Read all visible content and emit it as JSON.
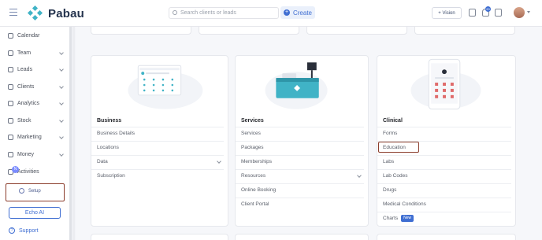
{
  "app": {
    "name": "Pabau",
    "brand_color": "#40b3c6",
    "accent_color": "#3f6ed2"
  },
  "header": {
    "search_placeholder": "Search clients or leads",
    "create_label": "Create",
    "vision_label": "+ Vision",
    "notification_count": "20"
  },
  "sidebar": {
    "items": [
      {
        "label": "Calendar",
        "icon": "calendar-icon",
        "has_caret": false
      },
      {
        "label": "Team",
        "icon": "team-icon",
        "has_caret": true
      },
      {
        "label": "Leads",
        "icon": "leads-icon",
        "has_caret": true
      },
      {
        "label": "Clients",
        "icon": "clients-icon",
        "has_caret": true
      },
      {
        "label": "Analytics",
        "icon": "analytics-icon",
        "has_caret": true
      },
      {
        "label": "Stock",
        "icon": "stock-icon",
        "has_caret": true
      },
      {
        "label": "Marketing",
        "icon": "marketing-icon",
        "has_caret": true
      },
      {
        "label": "Money",
        "icon": "money-icon",
        "has_caret": true
      },
      {
        "label": "Activities",
        "icon": "activities-icon",
        "has_caret": false
      }
    ],
    "activities_badge": "N",
    "setup_label": "Setup",
    "echo_label": "Echo AI",
    "support_label": "Support"
  },
  "sections": [
    {
      "title": "Business",
      "items": [
        {
          "label": "Business Details"
        },
        {
          "label": "Locations"
        },
        {
          "label": "Data",
          "expandable": true
        },
        {
          "label": "Subscription"
        }
      ]
    },
    {
      "title": "Services",
      "items": [
        {
          "label": "Services"
        },
        {
          "label": "Packages"
        },
        {
          "label": "Memberships"
        },
        {
          "label": "Resources",
          "expandable": true
        },
        {
          "label": "Online Booking"
        },
        {
          "label": "Client Portal"
        }
      ]
    },
    {
      "title": "Clinical",
      "items": [
        {
          "label": "Forms"
        },
        {
          "label": "Education",
          "highlighted": true
        },
        {
          "label": "Labs"
        },
        {
          "label": "Lab Codes"
        },
        {
          "label": "Drugs"
        },
        {
          "label": "Medical Conditions"
        },
        {
          "label": "Charts",
          "badge": "New"
        }
      ]
    }
  ]
}
